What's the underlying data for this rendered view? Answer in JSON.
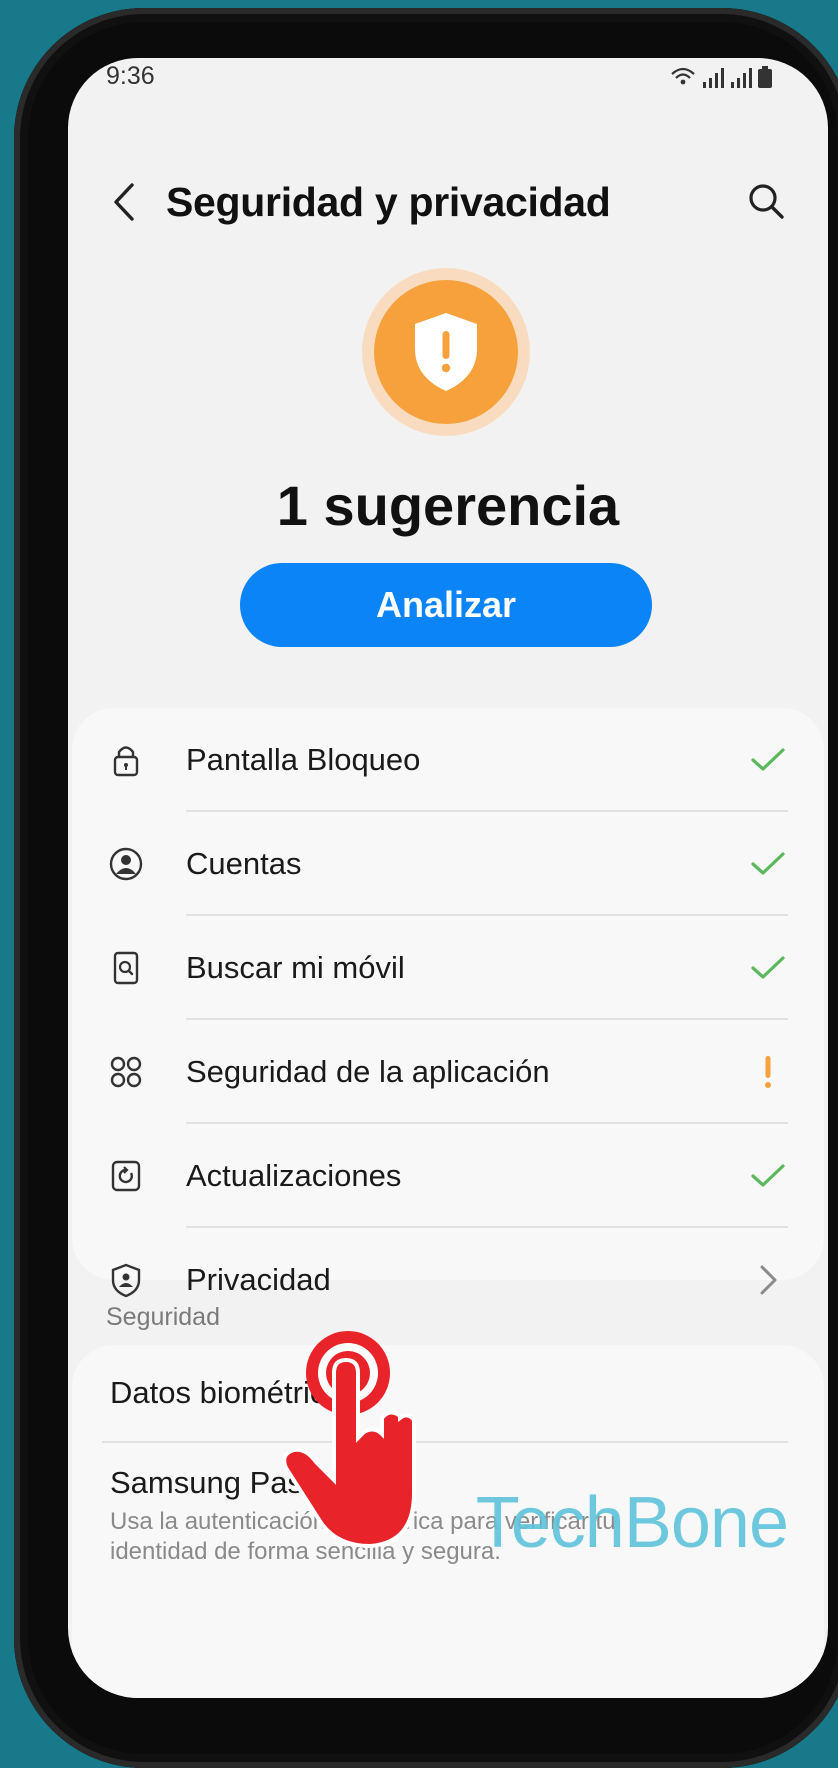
{
  "status_bar": {
    "time": "9:36"
  },
  "header": {
    "title": "Seguridad y privacidad"
  },
  "summary": {
    "suggestion_text": "1 sugerencia",
    "analyze_label": "Analizar"
  },
  "status_items": [
    {
      "label": "Pantalla Bloqueo",
      "icon": "lock-icon",
      "state": "ok"
    },
    {
      "label": "Cuentas",
      "icon": "account-icon",
      "state": "ok"
    },
    {
      "label": "Buscar mi móvil",
      "icon": "find-mobile-icon",
      "state": "ok"
    },
    {
      "label": "Seguridad de la aplicación",
      "icon": "app-security-icon",
      "state": "warning"
    },
    {
      "label": "Actualizaciones",
      "icon": "update-icon",
      "state": "ok"
    },
    {
      "label": "Privacidad",
      "icon": "privacy-icon",
      "state": "navigate"
    }
  ],
  "security_section": {
    "header": "Seguridad",
    "items": [
      {
        "label": "Datos biométricos"
      },
      {
        "label": "Samsung Pass",
        "description": "Usa la autenticación biométrica para verificar tu identidad de forma sencilla y segura."
      }
    ]
  },
  "watermark": "TechBone",
  "colors": {
    "accent": "#0a84f6",
    "ok": "#5cb85c",
    "warning": "#f7a13d",
    "tap": "#e8232a"
  }
}
